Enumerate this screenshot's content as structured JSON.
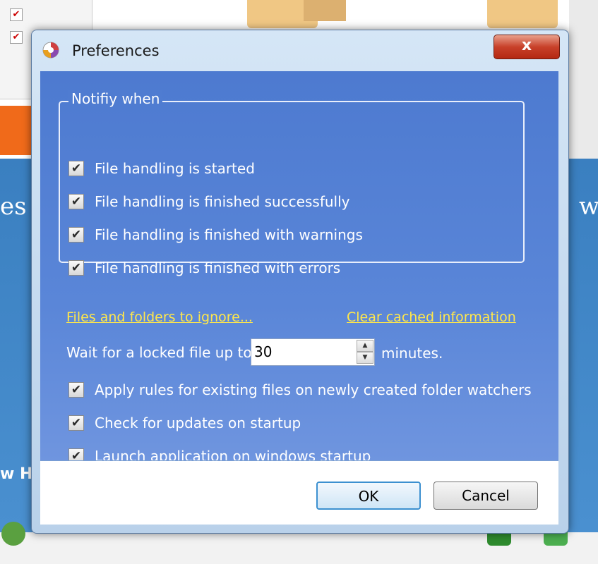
{
  "background": {
    "left_text": "es",
    "right_text": "w",
    "bottom_left_text": "w H"
  },
  "dialog": {
    "title": "Preferences",
    "close_label": "x",
    "app_icon": "preferences-app-icon"
  },
  "notify": {
    "legend": "Notifiy when",
    "items": [
      {
        "label": "File handling is started",
        "checked": true
      },
      {
        "label": "File handling is finished successfully",
        "checked": true
      },
      {
        "label": "File handling is finished with warnings",
        "checked": true
      },
      {
        "label": "File handling is finished with errors",
        "checked": true
      }
    ]
  },
  "links": {
    "ignore": "Files and folders to ignore...",
    "clear_cache": "Clear cached information"
  },
  "wait": {
    "label": "Wait for a locked file up to",
    "value": "30",
    "unit": "minutes."
  },
  "options": [
    {
      "label": "Apply rules for existing files on newly created folder watchers",
      "checked": true
    },
    {
      "label": "Check for updates on startup",
      "checked": true
    },
    {
      "label": "Launch application on windows startup",
      "checked": true
    }
  ],
  "buttons": {
    "ok": "OK",
    "cancel": "Cancel"
  },
  "check_glyph": "✔",
  "colors": {
    "panel": "#5a86d8",
    "link": "#ffe74a",
    "close": "#c8412a"
  }
}
